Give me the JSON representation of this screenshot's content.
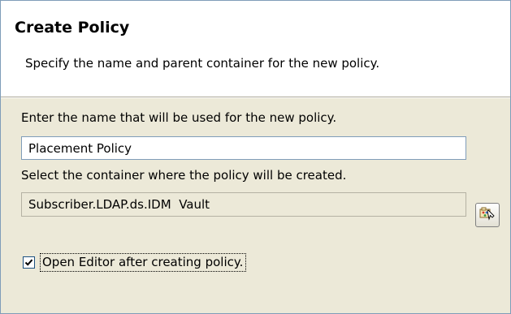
{
  "header": {
    "title": "Create Policy",
    "description": "Specify the name and parent container for the new policy."
  },
  "form": {
    "name_label": "Enter the name that will be used for the new policy.",
    "name_value": "Placement Policy",
    "container_label": "Select the container where the policy will be created.",
    "container_value": "Subscriber.LDAP.ds.IDM  Vault",
    "browse_icon": "container-browse-icon",
    "open_editor_label": "Open Editor after creating policy.",
    "open_editor_checked": true
  },
  "colors": {
    "dialog_background": "#ECE9D8",
    "header_background": "#FFFFFF",
    "input_border": "#7F9DB9"
  }
}
